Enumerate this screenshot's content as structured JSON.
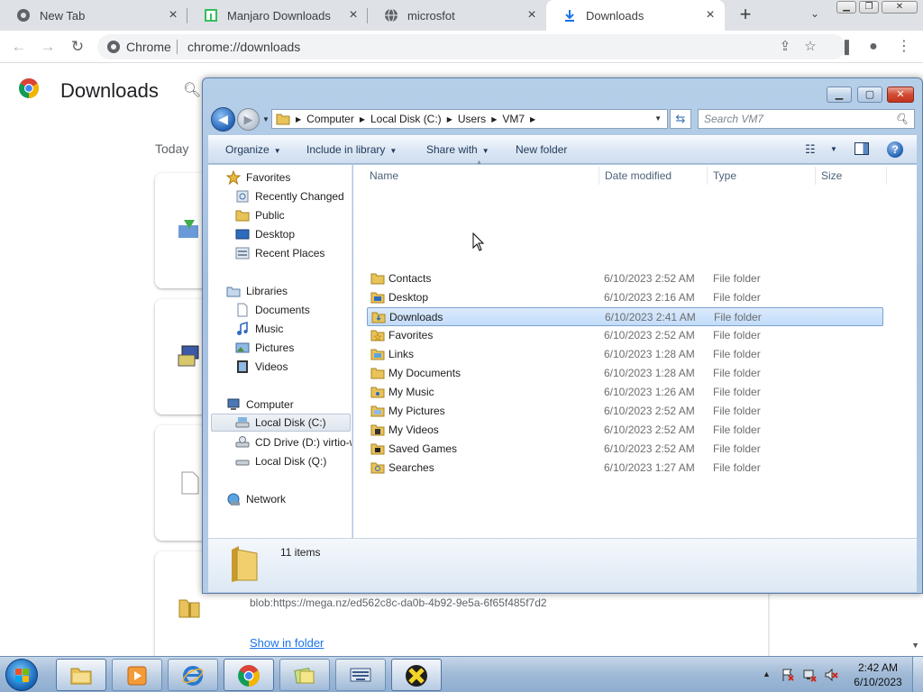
{
  "browser": {
    "tabs": [
      {
        "title": "New Tab",
        "icon": "chrome-icon"
      },
      {
        "title": "Manjaro Downloads",
        "icon": "manjaro-icon"
      },
      {
        "title": "microsfot",
        "icon": "globe-icon"
      },
      {
        "title": "Downloads",
        "icon": "download-icon",
        "active": true
      }
    ],
    "omnibox": {
      "site": "Chrome",
      "url": "chrome://downloads"
    }
  },
  "downloads_page": {
    "title": "Downloads",
    "section": "Today",
    "blob_url": "blob:https://mega.nz/ed562c8c-da0b-4b92-9e5a-6f65f485f7d2",
    "show_in_folder": "Show in folder"
  },
  "explorer": {
    "breadcrumb": [
      "Computer",
      "Local Disk (C:)",
      "Users",
      "VM7"
    ],
    "search_placeholder": "Search VM7",
    "commands": {
      "organize": "Organize",
      "include": "Include in library",
      "share": "Share with",
      "new_folder": "New folder"
    },
    "nav": {
      "favorites": "Favorites",
      "recently_changed": "Recently Changed",
      "public": "Public",
      "desktop": "Desktop",
      "recent_places": "Recent Places",
      "libraries": "Libraries",
      "documents": "Documents",
      "music": "Music",
      "pictures": "Pictures",
      "videos": "Videos",
      "computer": "Computer",
      "local_disk_c": "Local Disk (C:)",
      "cd_drive": "CD Drive (D:) virtio-w",
      "local_disk_q": "Local Disk (Q:)",
      "network": "Network"
    },
    "columns": {
      "name": "Name",
      "date": "Date modified",
      "type": "Type",
      "size": "Size"
    },
    "files": [
      {
        "name": "Contacts",
        "date": "6/10/2023 2:52 AM",
        "type": "File folder"
      },
      {
        "name": "Desktop",
        "date": "6/10/2023 2:16 AM",
        "type": "File folder"
      },
      {
        "name": "Downloads",
        "date": "6/10/2023 2:41 AM",
        "type": "File folder",
        "selected": true
      },
      {
        "name": "Favorites",
        "date": "6/10/2023 2:52 AM",
        "type": "File folder"
      },
      {
        "name": "Links",
        "date": "6/10/2023 1:28 AM",
        "type": "File folder"
      },
      {
        "name": "My Documents",
        "date": "6/10/2023 1:28 AM",
        "type": "File folder"
      },
      {
        "name": "My Music",
        "date": "6/10/2023 1:26 AM",
        "type": "File folder"
      },
      {
        "name": "My Pictures",
        "date": "6/10/2023 2:52 AM",
        "type": "File folder"
      },
      {
        "name": "My Videos",
        "date": "6/10/2023 2:52 AM",
        "type": "File folder"
      },
      {
        "name": "Saved Games",
        "date": "6/10/2023 2:52 AM",
        "type": "File folder"
      },
      {
        "name": "Searches",
        "date": "6/10/2023 1:27 AM",
        "type": "File folder"
      }
    ],
    "item_count": "11 items"
  },
  "taskbar": {
    "time": "2:42 AM",
    "date": "6/10/2023"
  },
  "colors": {
    "folder": "#e8c35a",
    "chrome_tab_bar": "#dee1e6",
    "link": "#1a73e8",
    "selection": "#c1dcfa"
  }
}
